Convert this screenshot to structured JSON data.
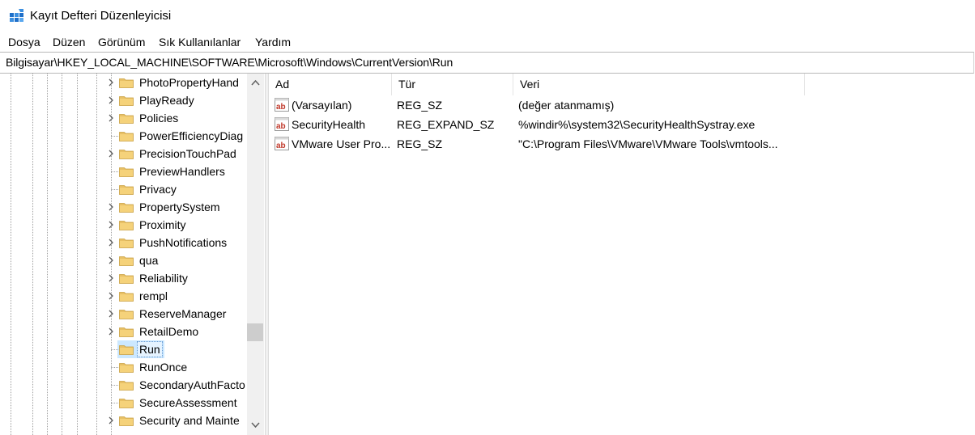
{
  "window": {
    "title": "Kayıt Defteri Düzenleyicisi",
    "icon": "registry-editor-icon"
  },
  "menu": [
    "Dosya",
    "Düzen",
    "Görünüm",
    "Sık Kullanılanlar",
    "Yardım"
  ],
  "address_bar": {
    "path": "Bilgisayar\\HKEY_LOCAL_MACHINE\\SOFTWARE\\Microsoft\\Windows\\CurrentVersion\\Run"
  },
  "tree": {
    "nodes": [
      {
        "label": "PhotoPropertyHand",
        "expandable": true
      },
      {
        "label": "PlayReady",
        "expandable": true
      },
      {
        "label": "Policies",
        "expandable": true
      },
      {
        "label": "PowerEfficiencyDiag",
        "expandable": false
      },
      {
        "label": "PrecisionTouchPad",
        "expandable": true
      },
      {
        "label": "PreviewHandlers",
        "expandable": false
      },
      {
        "label": "Privacy",
        "expandable": false
      },
      {
        "label": "PropertySystem",
        "expandable": true
      },
      {
        "label": "Proximity",
        "expandable": true
      },
      {
        "label": "PushNotifications",
        "expandable": true
      },
      {
        "label": "qua",
        "expandable": true
      },
      {
        "label": "Reliability",
        "expandable": true
      },
      {
        "label": "rempl",
        "expandable": true
      },
      {
        "label": "ReserveManager",
        "expandable": true
      },
      {
        "label": "RetailDemo",
        "expandable": true
      },
      {
        "label": "Run",
        "expandable": false,
        "selected": true
      },
      {
        "label": "RunOnce",
        "expandable": false
      },
      {
        "label": "SecondaryAuthFacto",
        "expandable": false
      },
      {
        "label": "SecureAssessment",
        "expandable": false
      },
      {
        "label": "Security and Mainte",
        "expandable": true
      }
    ]
  },
  "list": {
    "columns": [
      "Ad",
      "Tür",
      "Veri"
    ],
    "rows": [
      {
        "name": "(Varsayılan)",
        "type": "REG_SZ",
        "data": "(değer atanmamış)",
        "icon": "string-value-icon"
      },
      {
        "name": "SecurityHealth",
        "type": "REG_EXPAND_SZ",
        "data": "%windir%\\system32\\SecurityHealthSystray.exe",
        "icon": "string-value-icon"
      },
      {
        "name": "VMware User Pro...",
        "type": "REG_SZ",
        "data": "\"C:\\Program Files\\VMware\\VMware Tools\\vmtools...",
        "icon": "string-value-icon"
      }
    ]
  },
  "colors": {
    "folder": "#e8c065",
    "selection": "#cce8ff",
    "scrollbar_track": "#f0f0f0",
    "scrollbar_thumb": "#cdcdcd"
  }
}
